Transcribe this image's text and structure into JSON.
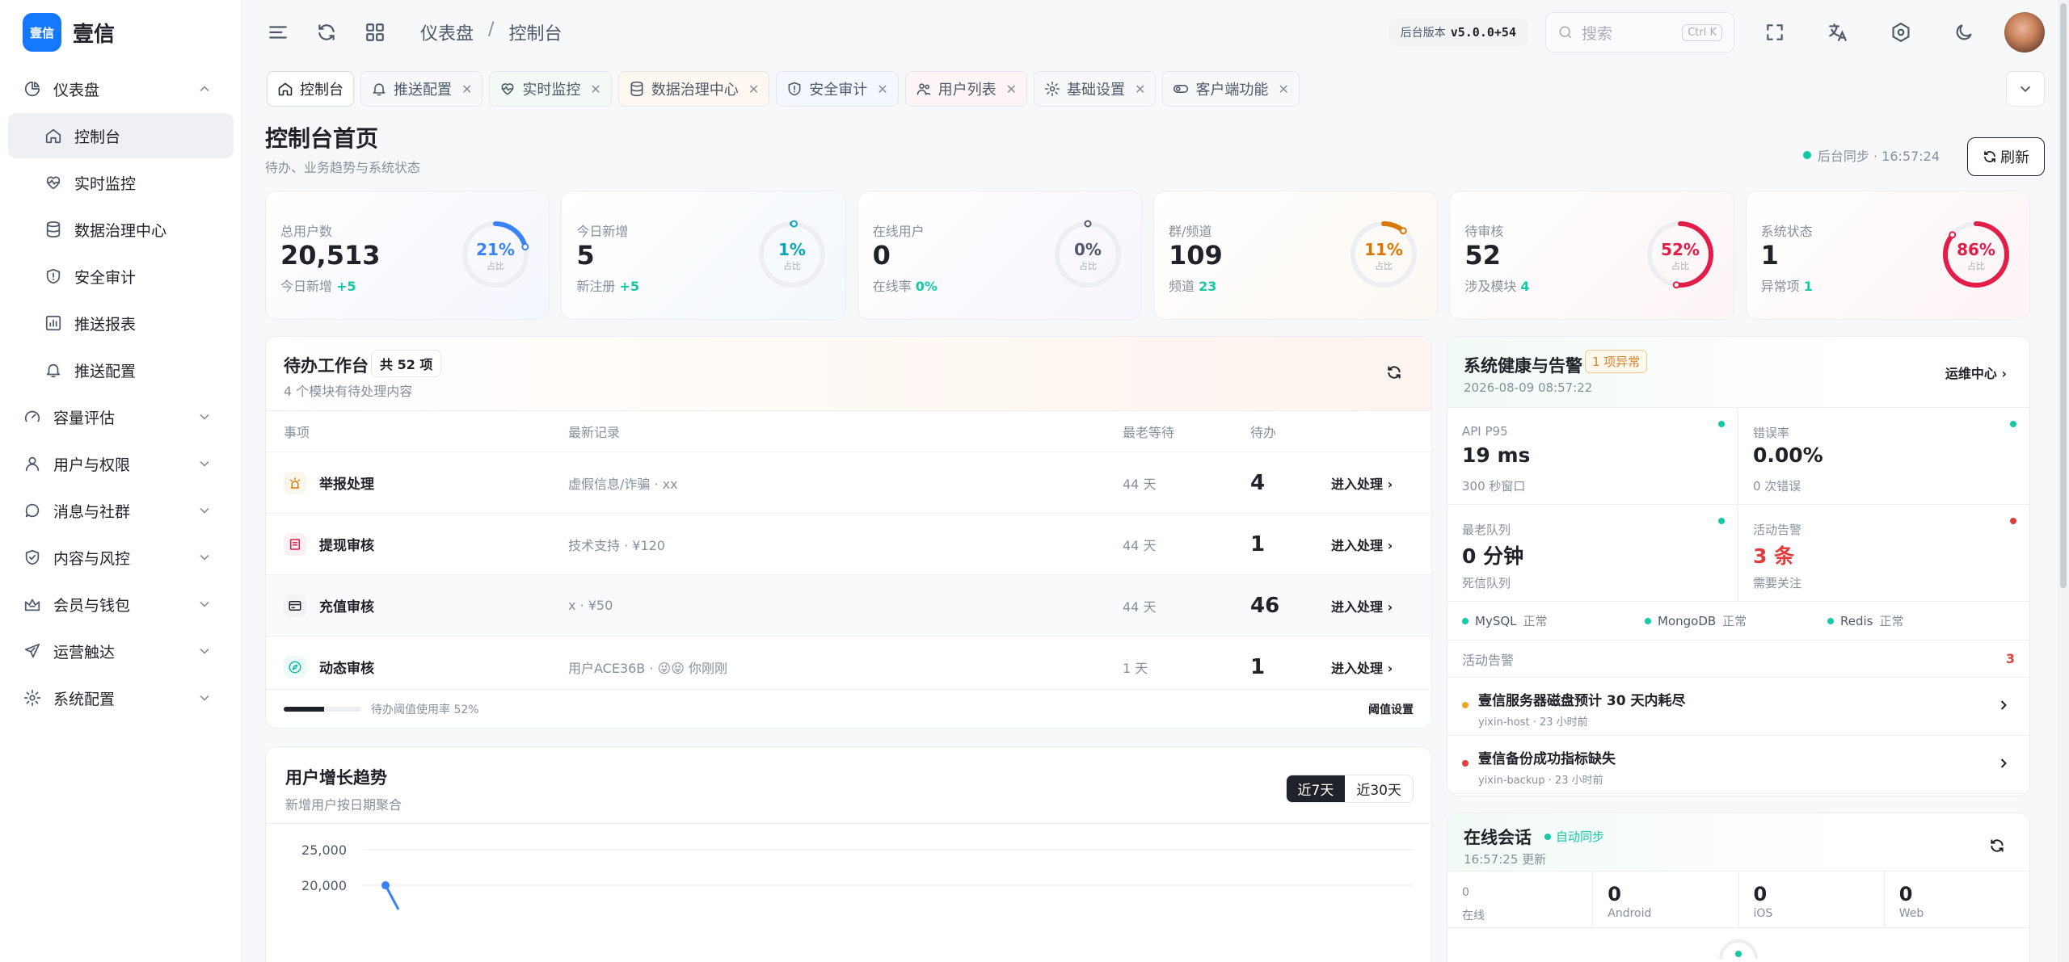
{
  "brand": {
    "logo_text": "壹信",
    "name": "壹信"
  },
  "sidebar": {
    "items": [
      {
        "label": "仪表盘",
        "icon": "pie-chart-icon",
        "type": "group-open"
      },
      {
        "label": "控制台",
        "icon": "home-icon",
        "type": "sub",
        "active": true
      },
      {
        "label": "实时监控",
        "icon": "heart-icon",
        "type": "sub"
      },
      {
        "label": "数据治理中心",
        "icon": "database-icon",
        "type": "sub"
      },
      {
        "label": "安全审计",
        "icon": "shield-icon",
        "type": "sub"
      },
      {
        "label": "推送报表",
        "icon": "bar-chart-icon",
        "type": "sub"
      },
      {
        "label": "推送配置",
        "icon": "bell-icon",
        "type": "sub"
      },
      {
        "label": "容量评估",
        "icon": "gauge-icon",
        "type": "group"
      },
      {
        "label": "用户与权限",
        "icon": "user-icon",
        "type": "group"
      },
      {
        "label": "消息与社群",
        "icon": "chat-icon",
        "type": "group"
      },
      {
        "label": "内容与风控",
        "icon": "shield-check-icon",
        "type": "group"
      },
      {
        "label": "会员与钱包",
        "icon": "crown-icon",
        "type": "group"
      },
      {
        "label": "运营触达",
        "icon": "send-icon",
        "type": "group"
      },
      {
        "label": "系统配置",
        "icon": "gear-icon",
        "type": "group"
      }
    ]
  },
  "topbar": {
    "breadcrumb": [
      "仪表盘",
      "控制台"
    ],
    "breadcrumb_sep": "/",
    "version_label": "后台版本",
    "version": "v5.0.0+54",
    "search_placeholder": "搜索",
    "search_kbd": "Ctrl K"
  },
  "tabs": [
    {
      "label": "控制台",
      "icon": "home-icon",
      "active": true,
      "tone": "white"
    },
    {
      "label": "推送配置",
      "icon": "bell-icon",
      "tone": "white"
    },
    {
      "label": "实时监控",
      "icon": "heart-icon",
      "tone": "green"
    },
    {
      "label": "数据治理中心",
      "icon": "database-icon",
      "tone": "orange"
    },
    {
      "label": "安全审计",
      "icon": "shield-icon",
      "tone": "blue"
    },
    {
      "label": "用户列表",
      "icon": "users-icon",
      "tone": "pink"
    },
    {
      "label": "基础设置",
      "icon": "gear-icon",
      "tone": "white"
    },
    {
      "label": "客户端功能",
      "icon": "toggle-icon",
      "tone": "white"
    }
  ],
  "page": {
    "title": "控制台首页",
    "subtitle": "待办、业务趋势与系统状态",
    "sync_text": "后台同步 · 16:57:24",
    "refresh_label": "刷新"
  },
  "stats": [
    {
      "label": "总用户数",
      "value": "20,513",
      "note": "今日新增",
      "note_val": "+5",
      "pct": 21,
      "pct_text": "21%",
      "ring_label": "占比",
      "color": "#3b82f6",
      "bg": "#f3f6fd"
    },
    {
      "label": "今日新增",
      "value": "5",
      "note": "新注册",
      "note_val": "+5",
      "pct": 1,
      "pct_text": "1%",
      "ring_label": "占比",
      "color": "#0ea5b7",
      "bg": "#f3f8fb"
    },
    {
      "label": "在线用户",
      "value": "0",
      "note": "在线率",
      "note_val": "0%",
      "pct": 0,
      "pct_text": "0%",
      "ring_label": "占比",
      "color": "#4e5969",
      "bg": "#f7f5fd"
    },
    {
      "label": "群/频道",
      "value": "109",
      "note": "频道",
      "note_val": "23",
      "pct": 11,
      "pct_text": "11%",
      "ring_label": "占比",
      "color": "#d97706",
      "bg": "#fdf8f2"
    },
    {
      "label": "待审核",
      "value": "52",
      "note": "涉及模块",
      "note_val": "4",
      "pct": 52,
      "pct_text": "52%",
      "ring_label": "占比",
      "color": "#e11d48",
      "bg": "#fdf4f6"
    },
    {
      "label": "系统状态",
      "value": "1",
      "note": "异常项",
      "note_val": "1",
      "pct": 86,
      "pct_text": "86%",
      "ring_label": "占比",
      "color": "#e11d48",
      "bg": "#fdf3f5"
    }
  ],
  "todo": {
    "title": "待办工作台",
    "count": "共 52 项",
    "subtitle": "4 个模块有待处理内容",
    "columns": [
      "事项",
      "最新记录",
      "最老等待",
      "待办",
      ""
    ],
    "rows": [
      {
        "name": "举报处理",
        "icon": "alarm-icon",
        "icon_color": "#d97706",
        "icon_bg": "#fdf6ec",
        "latest": "虚假信息/诈骗 · xx",
        "wait": "44 天",
        "count": "4",
        "action": "进入处理"
      },
      {
        "name": "提现审核",
        "icon": "receipt-icon",
        "icon_color": "#e11d48",
        "icon_bg": "#fdf0f2",
        "latest": "技术支持 · ¥120",
        "wait": "44 天",
        "count": "1",
        "action": "进入处理"
      },
      {
        "name": "充值审核",
        "icon": "card-icon",
        "icon_color": "#1f2329",
        "icon_bg": "#f2f3f5",
        "latest": "x · ¥50",
        "wait": "44 天",
        "count": "46",
        "action": "进入处理"
      },
      {
        "name": "动态审核",
        "icon": "compass-icon",
        "icon_color": "#14b8a6",
        "icon_bg": "#eefaf7",
        "latest": "用户ACE36B · 😜😝 你刚刚",
        "wait": "1 天",
        "count": "1",
        "action": "进入处理"
      }
    ],
    "threshold_pct": 52,
    "threshold_text": "待办阈值使用率 52%",
    "threshold_link": "阈值设置"
  },
  "growth": {
    "title": "用户增长趋势",
    "subtitle": "新增用户按日期聚合",
    "ranges": [
      "近7天",
      "近30天"
    ],
    "active_range": "近7天"
  },
  "chart_data": {
    "type": "line",
    "title": "用户增长趋势",
    "ytick_labels": [
      "25,000",
      "20,000"
    ],
    "ylim": [
      0,
      25000
    ],
    "grid": true,
    "series": [
      {
        "values": [
          20000
        ]
      }
    ]
  },
  "health": {
    "title": "系统健康与告警",
    "badge": "1 项异常",
    "time": "2026-08-09 08:57:22",
    "link": "运维中心",
    "metrics": [
      {
        "label": "API P95",
        "value": "19 ms",
        "note": "300 秒窗口",
        "dot": "#14c9a5",
        "red": false
      },
      {
        "label": "错误率",
        "value": "0.00%",
        "note": "0 次错误",
        "dot": "#14c9a5",
        "red": false
      },
      {
        "label": "最老队列",
        "value": "0 分钟",
        "note": "死信队列",
        "dot": "#14c9a5",
        "red": false
      },
      {
        "label": "活动告警",
        "value": "3 条",
        "note": "需要关注",
        "dot": "#e03e3e",
        "red": true
      }
    ],
    "dbs": [
      {
        "name": "MySQL",
        "status": "正常"
      },
      {
        "name": "MongoDB",
        "status": "正常"
      },
      {
        "name": "Redis",
        "status": "正常"
      }
    ],
    "alerts_label": "活动告警",
    "alerts_count": "3",
    "alerts": [
      {
        "title": "壹信服务器磁盘预计 30 天内耗尽",
        "sub": "yixin-host · 23 小时前",
        "dot": "#f5a524"
      },
      {
        "title": "壹信备份成功指标缺失",
        "sub": "yixin-backup · 23 小时前",
        "dot": "#e03e3e"
      }
    ]
  },
  "online": {
    "title": "在线会话",
    "auto": "自动同步",
    "time": "16:57:25 更新",
    "cells": [
      {
        "value": "0",
        "label": "在线",
        "small": true
      },
      {
        "value": "0",
        "label": "Android",
        "small": false
      },
      {
        "value": "0",
        "label": "iOS",
        "small": false
      },
      {
        "value": "0",
        "label": "Web",
        "small": false
      }
    ]
  }
}
